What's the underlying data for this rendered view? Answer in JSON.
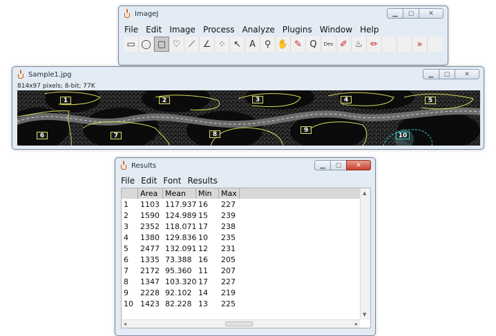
{
  "imagej": {
    "title": "ImageJ",
    "menu": [
      "File",
      "Edit",
      "Image",
      "Process",
      "Analyze",
      "Plugins",
      "Window",
      "Help"
    ],
    "tools": [
      {
        "name": "rectangle-tool-icon",
        "glyph": "▭"
      },
      {
        "name": "oval-tool-icon",
        "glyph": "◯"
      },
      {
        "name": "rounded-rect-tool-icon",
        "glyph": "▢"
      },
      {
        "name": "freehand-tool-icon",
        "glyph": "♡"
      },
      {
        "name": "line-tool-icon",
        "glyph": "⟋"
      },
      {
        "name": "angle-tool-icon",
        "glyph": "∠"
      },
      {
        "name": "multipoint-tool-icon",
        "glyph": "⁘"
      },
      {
        "name": "wand-tool-icon",
        "glyph": "↖"
      },
      {
        "name": "text-tool-icon",
        "glyph": "A"
      },
      {
        "name": "magnifier-tool-icon",
        "glyph": "⚲"
      },
      {
        "name": "hand-tool-icon",
        "glyph": "✋"
      },
      {
        "name": "color-picker-tool-icon",
        "glyph": "✎"
      },
      {
        "name": "zoom-tool-icon",
        "glyph": "Q"
      },
      {
        "name": "dev-tool-icon",
        "glyph": "Dev"
      },
      {
        "name": "brush-tool-icon",
        "glyph": "✐"
      },
      {
        "name": "flood-fill-tool-icon",
        "glyph": "♨"
      },
      {
        "name": "pencil-tool-icon",
        "glyph": "✏"
      },
      {
        "name": "blank-tool-1-icon",
        "glyph": ""
      },
      {
        "name": "blank-tool-2-icon",
        "glyph": ""
      },
      {
        "name": "more-tools-icon",
        "glyph": "»"
      }
    ]
  },
  "sample": {
    "title": "Sample1.jpg",
    "info": "814x97 pixels; 8-bit; 77K",
    "labels": [
      "1",
      "2",
      "3",
      "4",
      "5",
      "6",
      "7",
      "8",
      "9",
      "10"
    ]
  },
  "results": {
    "title": "Results",
    "menu": [
      "File",
      "Edit",
      "Font",
      "Results"
    ],
    "columns": [
      "",
      "Area",
      "Mean",
      "Min",
      "Max"
    ],
    "rows": [
      [
        "1",
        "1103",
        "117.937",
        "16",
        "227"
      ],
      [
        "2",
        "1590",
        "124.989",
        "15",
        "239"
      ],
      [
        "3",
        "2352",
        "118.071",
        "17",
        "238"
      ],
      [
        "4",
        "1380",
        "129.836",
        "10",
        "235"
      ],
      [
        "5",
        "2477",
        "132.091",
        "12",
        "231"
      ],
      [
        "6",
        "1335",
        "73.388",
        "16",
        "205"
      ],
      [
        "7",
        "2172",
        "95.360",
        "11",
        "207"
      ],
      [
        "8",
        "1347",
        "103.320",
        "17",
        "227"
      ],
      [
        "9",
        "2228",
        "92.102",
        "14",
        "219"
      ],
      [
        "10",
        "1423",
        "82.228",
        "13",
        "225"
      ]
    ]
  }
}
